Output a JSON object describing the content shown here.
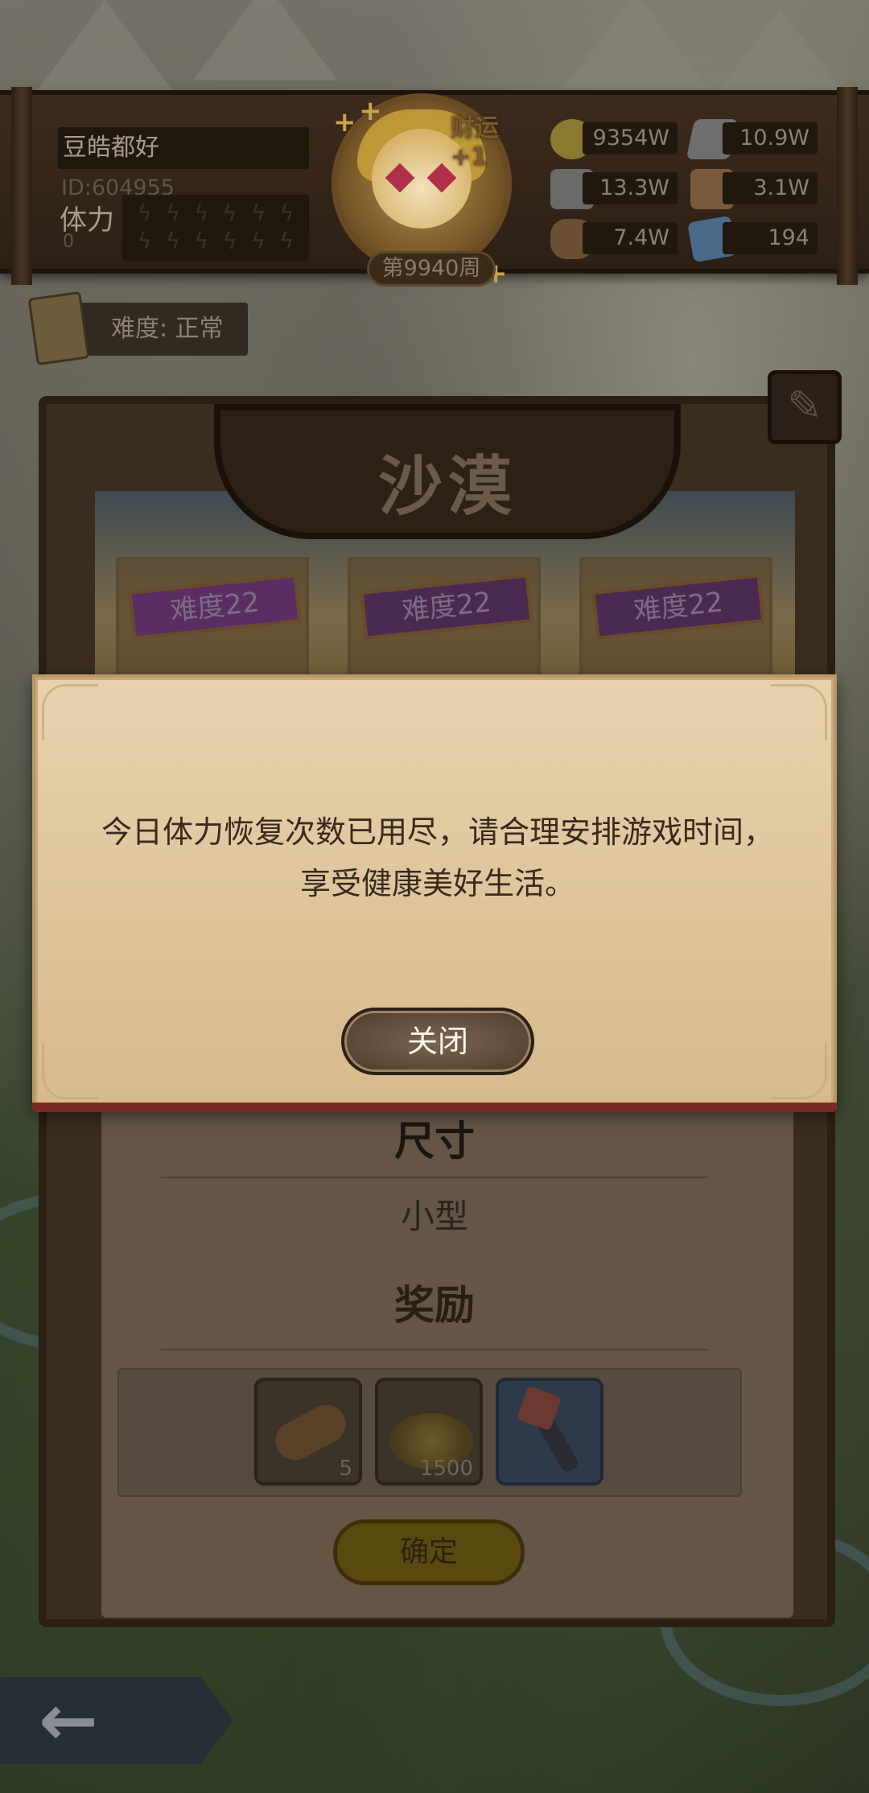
{
  "player": {
    "name": "豆皓都好",
    "id_text": "ID:604955",
    "stamina_label": "体力",
    "stamina_value": "0"
  },
  "avatar": {
    "fortune_text": "财运+1",
    "week_text": "第9940周"
  },
  "resources": [
    {
      "name": "gold",
      "value": "9354W",
      "color": "#8a7a30"
    },
    {
      "name": "iron",
      "value": "10.9W",
      "color": "#6e6e6e"
    },
    {
      "name": "stone",
      "value": "13.3W",
      "color": "#6a6a68"
    },
    {
      "name": "leather",
      "value": "3.1W",
      "color": "#7a5a3a"
    },
    {
      "name": "wood",
      "value": "7.4W",
      "color": "#6a5030"
    },
    {
      "name": "crystal",
      "value": "194",
      "color": "#4a6a8a"
    }
  ],
  "difficulty": {
    "label": "难度: 正常"
  },
  "stage": {
    "title": "沙漠",
    "cards": [
      {
        "label": "难度22"
      },
      {
        "label": "难度22"
      },
      {
        "label": "难度22"
      }
    ],
    "size_title": "尺寸",
    "size_value": "小型",
    "reward_title": "奖励",
    "rewards": [
      {
        "name": "wood-log",
        "qty": "5"
      },
      {
        "name": "gold-coins",
        "qty": "1500"
      },
      {
        "name": "torch",
        "qty": ""
      }
    ],
    "confirm_label": "确定"
  },
  "modal": {
    "message": "今日体力恢复次数已用尽，请合理安排游戏时间，享受健康美好生活。",
    "close_label": "关闭"
  },
  "colors": {
    "modal_bg": "#dec59d",
    "modal_text": "#3a2a1e",
    "button_bg": "#5c4636"
  }
}
